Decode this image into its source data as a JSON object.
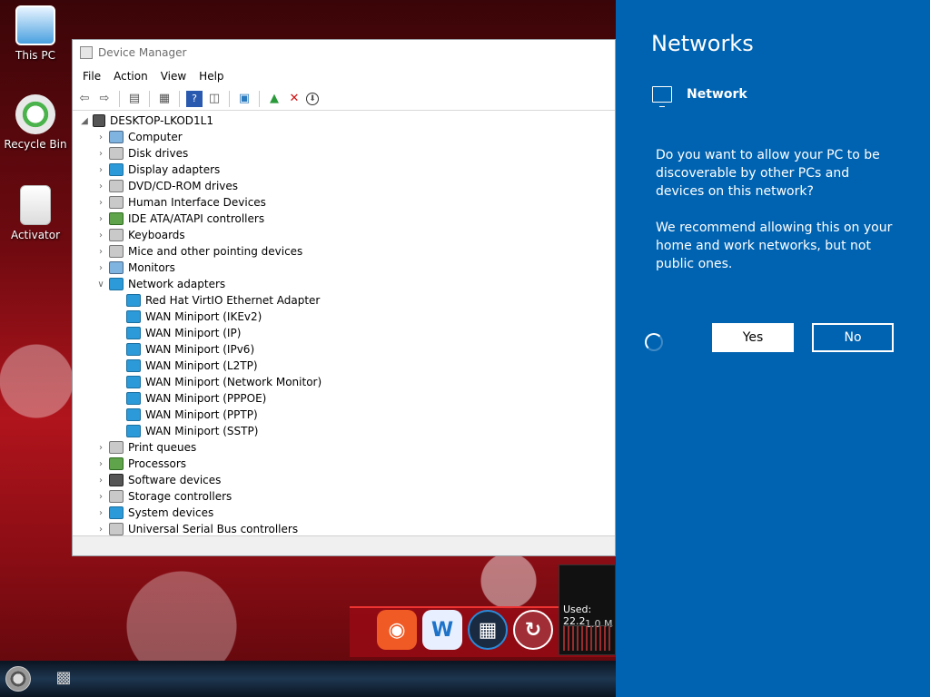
{
  "desktop": {
    "icons": [
      {
        "label": "This PC"
      },
      {
        "label": "Recycle Bin"
      },
      {
        "label": "Activator"
      }
    ]
  },
  "window": {
    "title": "Device Manager",
    "menu": [
      "File",
      "Action",
      "View",
      "Help"
    ],
    "tree": {
      "root": "DESKTOP-LKOD1L1",
      "categories": [
        "Computer",
        "Disk drives",
        "Display adapters",
        "DVD/CD-ROM drives",
        "Human Interface Devices",
        "IDE ATA/ATAPI controllers",
        "Keyboards",
        "Mice and other pointing devices",
        "Monitors",
        "Network adapters"
      ],
      "network_children": [
        "Red Hat VirtIO Ethernet Adapter",
        "WAN Miniport (IKEv2)",
        "WAN Miniport (IP)",
        "WAN Miniport (IPv6)",
        "WAN Miniport (L2TP)",
        "WAN Miniport (Network Monitor)",
        "WAN Miniport (PPPOE)",
        "WAN Miniport (PPTP)",
        "WAN Miniport (SSTP)"
      ],
      "more_categories": [
        "Print queues",
        "Processors",
        "Software devices",
        "Storage controllers",
        "System devices",
        "Universal Serial Bus controllers"
      ]
    }
  },
  "monitor": {
    "used": "Used: 22.2",
    "mem": "1.0 M"
  },
  "flyout": {
    "title": "Networks",
    "network_name": "Network",
    "question": "Do you want to allow your PC to be discoverable by other PCs and devices on this network?",
    "recommendation": "We recommend allowing this on your home and work networks, but not public ones.",
    "yes_label": "Yes",
    "no_label": "No",
    "accent_color": "#0063b1"
  }
}
